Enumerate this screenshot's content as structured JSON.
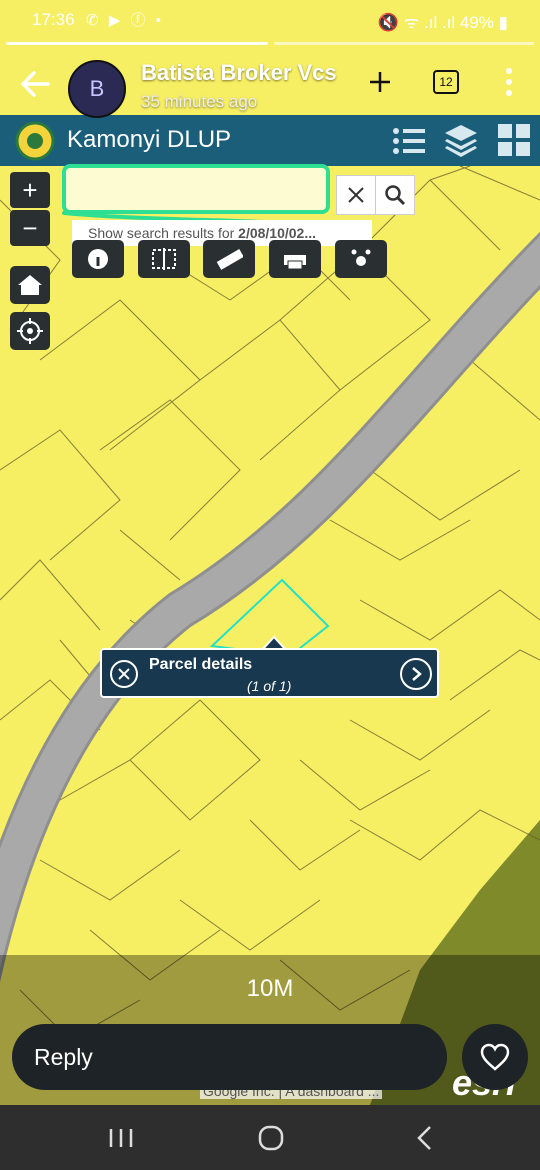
{
  "status_bar": {
    "time": "17:36",
    "left_icons": "✆ ▶ ⓕ •",
    "right_status": "🔇 ᯤ .ıl .ıl 49% ▮"
  },
  "story": {
    "avatar_letter": "B",
    "poster_name": "Batista Broker Vcs",
    "posted_time": "35 minutes ago",
    "tab_count": "12"
  },
  "app": {
    "title": "Kamonyi DLUP",
    "colors": {
      "header": "#1b5e7a",
      "map_fill": "#f7ef63",
      "road": "#a6a6a6",
      "highlight": "#2dde93"
    }
  },
  "search": {
    "value": "",
    "hint_prefix": "Show search results for ",
    "hint_query": "2/08/10/02..."
  },
  "popup": {
    "title": "Parcel details",
    "counter": "(1 of 1)"
  },
  "video": {
    "length": "10M"
  },
  "reply": {
    "label": "Reply"
  },
  "map_attribution": "Google Inc. | A dashboard ...",
  "esri_mark": "esri"
}
